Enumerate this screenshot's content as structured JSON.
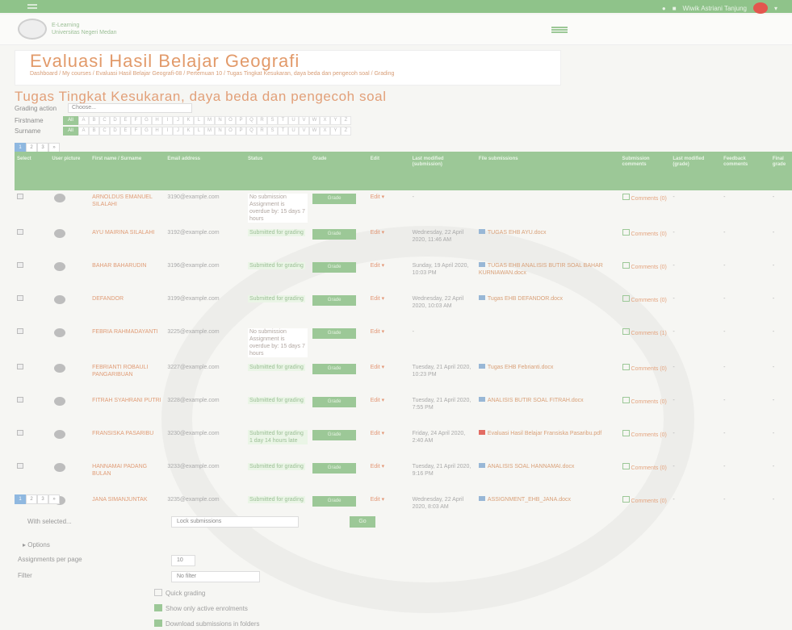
{
  "topbar": {
    "user_text": "Wiwik Astriani Tanjung"
  },
  "header": {
    "brand_line1": "E-Learning",
    "brand_line2": "Universitas Negeri Medan"
  },
  "course": {
    "title": "Evaluasi Hasil Belajar Geografi",
    "breadcrumb": "Dashboard / My courses / Evaluasi Hasil Belajar Geografi-08 / Pertemuan 10 / Tugas Tingkat Kesukaran, daya beda dan pengecoh soal / Grading"
  },
  "assignment": {
    "title": "Tugas Tingkat Kesukaran, daya beda dan pengecoh soal",
    "group_label": "Grading action",
    "group_value": "Choose...",
    "firstname_label": "Firstname",
    "surname_label": "Surname",
    "letters": [
      "All",
      "A",
      "B",
      "C",
      "D",
      "E",
      "F",
      "G",
      "H",
      "I",
      "J",
      "K",
      "L",
      "M",
      "N",
      "O",
      "P",
      "Q",
      "R",
      "S",
      "T",
      "U",
      "V",
      "W",
      "X",
      "Y",
      "Z"
    ]
  },
  "pagination": [
    "1",
    "2",
    "3",
    "»"
  ],
  "table": {
    "headers": [
      "Select",
      "User picture",
      "First name / Surname",
      "Email address",
      "Status",
      "Grade",
      "Edit",
      "Last modified (submission)",
      "File submissions",
      "Submission comments",
      "Last modified (grade)",
      "Feedback comments",
      "Final grade"
    ],
    "rows": [
      {
        "name": "ARNOLDUS EMANUEL SILALAHI",
        "email": "3190@example.com",
        "status": "No submission Assignment is overdue by: 15 days 7 hours",
        "submitted": false,
        "edit": "Edit",
        "modified": "-",
        "file": "",
        "comments": "Comments (0)"
      },
      {
        "name": "AYU MAIRINA SILALAHI",
        "email": "3192@example.com",
        "status": "Submitted for grading",
        "submitted": true,
        "edit": "Edit",
        "modified": "Wednesday, 22 April 2020, 11:46 AM",
        "file": "TUGAS EHB AYU.docx",
        "comments": "Comments (0)"
      },
      {
        "name": "BAHAR BAHARUDIN",
        "email": "3196@example.com",
        "status": "Submitted for grading",
        "submitted": true,
        "edit": "Edit",
        "modified": "Sunday, 19 April 2020, 10:03 PM",
        "file": "TUGAS EHB ANALISIS BUTIR SOAL BAHAR KURNIAWAN.docx",
        "comments": "Comments (0)"
      },
      {
        "name": "DEFANDOR",
        "email": "3199@example.com",
        "status": "Submitted for grading",
        "submitted": true,
        "edit": "Edit",
        "modified": "Wednesday, 22 April 2020, 10:03 AM",
        "file": "Tugas EHB DEFANDOR.docx",
        "comments": "Comments (0)"
      },
      {
        "name": "FEBRIA RAHMADAYANTI",
        "email": "3225@example.com",
        "status": "No submission Assignment is overdue by: 15 days 7 hours",
        "submitted": false,
        "edit": "Edit",
        "modified": "-",
        "file": "",
        "comments": "Comments (1)"
      },
      {
        "name": "FEBRIANTI ROBAULI PANGARIBUAN",
        "email": "3227@example.com",
        "status": "Submitted for grading",
        "submitted": true,
        "edit": "Edit",
        "modified": "Tuesday, 21 April 2020, 10:23 PM",
        "file": "Tugas EHB Febrianti.docx",
        "comments": "Comments (0)"
      },
      {
        "name": "FITRAH SYAHRANI PUTRI",
        "email": "3228@example.com",
        "status": "Submitted for grading",
        "submitted": true,
        "edit": "Edit",
        "modified": "Tuesday, 21 April 2020, 7:55 PM",
        "file": "ANALISIS BUTIR SOAL FITRAH.docx",
        "comments": "Comments (0)"
      },
      {
        "name": "FRANSISKA PASARIBU",
        "email": "3230@example.com",
        "status": "Submitted for grading 1 day 14 hours late",
        "submitted": true,
        "edit": "Edit",
        "modified": "Friday, 24 April 2020, 2:40 AM",
        "file": "Evaluasi Hasil Belajar Fransiska Pasaribu.pdf",
        "comments": "Comments (0)"
      },
      {
        "name": "HANNAMAI PADANG BULAN",
        "email": "3233@example.com",
        "status": "Submitted for grading",
        "submitted": true,
        "edit": "Edit",
        "modified": "Tuesday, 21 April 2020, 9:16 PM",
        "file": "ANALISIS SOAL HANNAMAI.docx",
        "comments": "Comments (0)"
      },
      {
        "name": "JANA SIMANJUNTAK",
        "email": "3235@example.com",
        "status": "Submitted for grading",
        "submitted": true,
        "edit": "Edit",
        "modified": "Wednesday, 22 April 2020, 8:03 AM",
        "file": "ASSIGNMENT_EHB_JANA.docx",
        "comments": "Comments (0)"
      }
    ],
    "grade_label": "Grade"
  },
  "form": {
    "with_selected": "With selected...",
    "with_selected_value": "Lock submissions",
    "go": "Go",
    "options_toggle": "Options",
    "per_page_label": "Assignments per page",
    "per_page_value": "10",
    "filter_label": "Filter",
    "filter_value": "No filter",
    "quick_grading": "Quick grading",
    "only_active": "Show only active enrolments",
    "download_folders": "Download submissions in folders"
  }
}
